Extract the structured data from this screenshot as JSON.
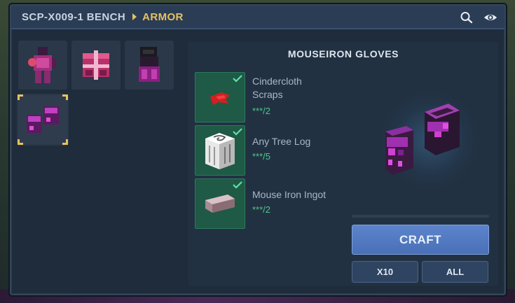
{
  "header": {
    "bench_name": "SCP-X009-1 BENCH",
    "category": "ARMOR",
    "icons": [
      "search-icon",
      "eye-icon"
    ]
  },
  "recipes": [
    {
      "name": "armor-chest-icon",
      "selected": false
    },
    {
      "name": "armor-box-icon",
      "selected": false
    },
    {
      "name": "armor-legs-icon",
      "selected": false
    },
    {
      "name": "gloves-icon",
      "selected": true
    }
  ],
  "detail": {
    "title": "MOUSEIRON GLOVES",
    "ingredients": [
      {
        "name": "Cindercloth Scraps",
        "qty": "***/2",
        "icon": "cloth-scrap-icon",
        "ready": true
      },
      {
        "name": "Any Tree Log",
        "qty": "***/5",
        "icon": "tree-log-icon",
        "ready": true
      },
      {
        "name": "Mouse Iron Ingot",
        "qty": "***/2",
        "icon": "iron-ingot-icon",
        "ready": true
      }
    ],
    "progress": 0,
    "craft_label": "CRAFT",
    "x10_label": "X10",
    "all_label": "ALL"
  },
  "colors": {
    "accent": "#e8c060",
    "ready": "#49c98a",
    "craft": "#5c84cc"
  }
}
